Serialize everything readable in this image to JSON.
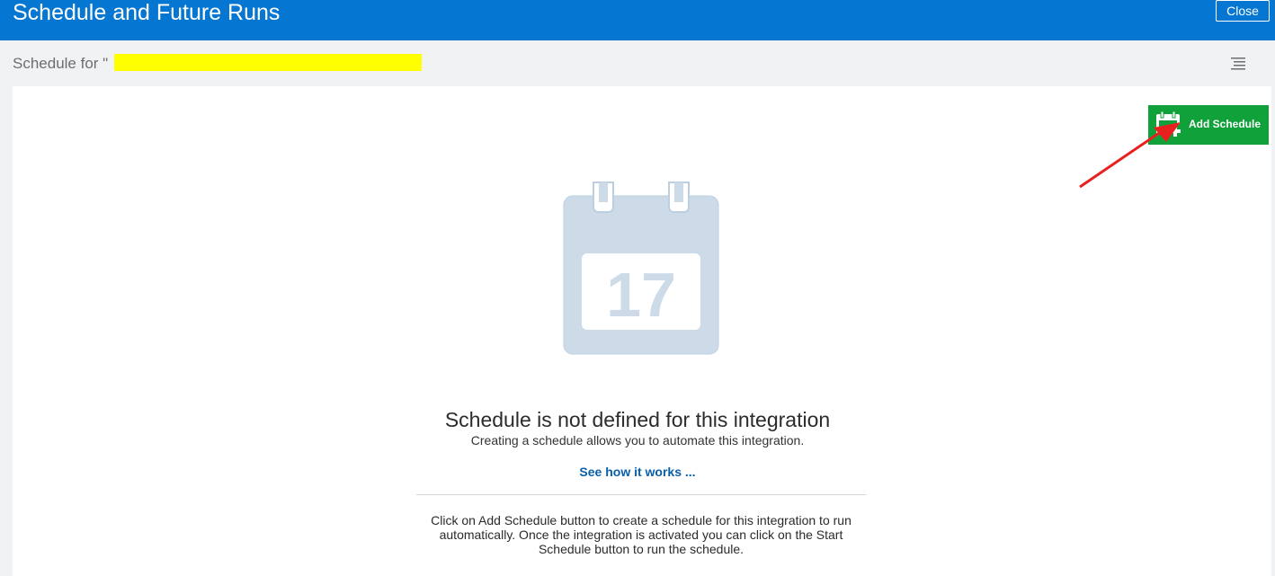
{
  "header": {
    "title": "Schedule and Future Runs",
    "close_label": "Close"
  },
  "subheader": {
    "text": "Schedule for \""
  },
  "toolbar": {
    "add_schedule_label": "Add Schedule"
  },
  "empty_state": {
    "calendar_day": "17",
    "title": "Schedule is not defined for this integration",
    "subtitle": "Creating a schedule allows you to automate this integration.",
    "link": "See how it works ...",
    "instructions": "Click on Add Schedule button to create a schedule for this integration to run automatically. Once the integration is activated you can click on the Start Schedule button to run the schedule."
  },
  "colors": {
    "header_bg": "#0576d1",
    "add_button_bg": "#10a13b",
    "link": "#0a5fa8",
    "calendar": "#cddbe9",
    "redaction": "#ffff00",
    "annotation_arrow": "#e8211e"
  },
  "icons": [
    "menu-lines-icon",
    "calendar-add-icon",
    "calendar-icon"
  ]
}
